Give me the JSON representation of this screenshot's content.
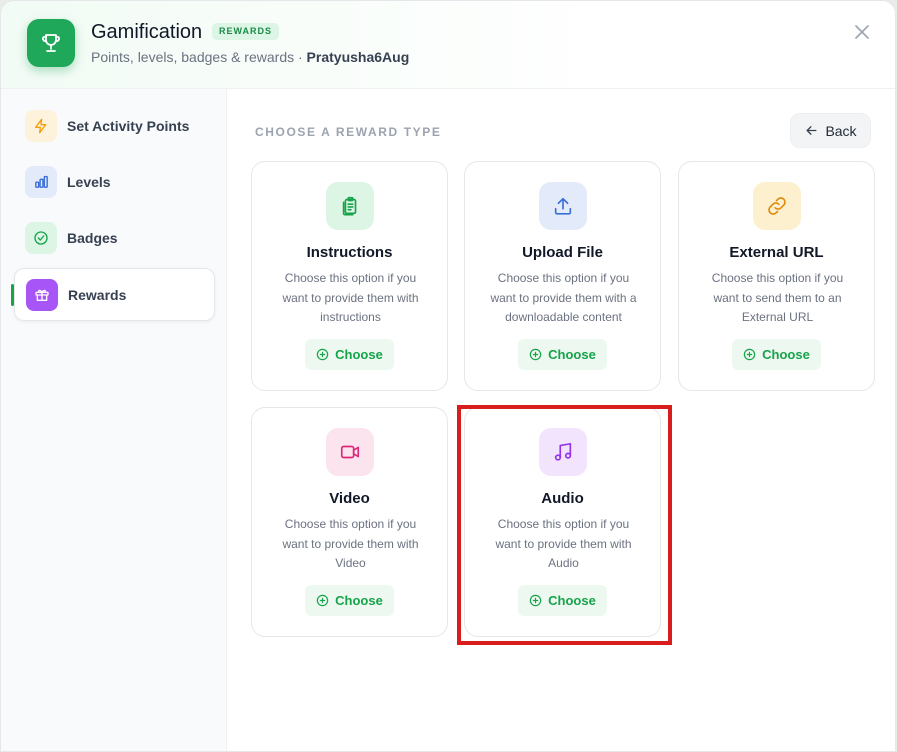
{
  "header": {
    "title": "Gamification",
    "badge": "REWARDS",
    "subtitle": "Points, levels, badges & rewards · ",
    "user": "Pratyusha6Aug"
  },
  "sidebar": {
    "items": [
      {
        "label": "Set Activity Points",
        "icon": "bolt-icon",
        "color": "#f59e0b",
        "bg": "#fdf3dc"
      },
      {
        "label": "Levels",
        "icon": "bar-chart-icon",
        "color": "#3b6fd8",
        "bg": "#e3ebfb"
      },
      {
        "label": "Badges",
        "icon": "check-circle-icon",
        "color": "#16a34a",
        "bg": "#dcf5e4"
      },
      {
        "label": "Rewards",
        "icon": "gift-icon",
        "color": "#ffffff",
        "bg": "#a855f7",
        "active": true
      }
    ]
  },
  "main": {
    "section_title": "CHOOSE A REWARD TYPE",
    "back_label": "Back",
    "choose_label": "Choose",
    "cards": [
      {
        "title": "Instructions",
        "desc": "Choose this option if you want to provide them with instructions",
        "icon": "clipboard-icon",
        "color": "#16a34a",
        "bg": "#dcf5e4"
      },
      {
        "title": "Upload File",
        "desc": "Choose this option if you want to provide them with a downloadable content",
        "icon": "upload-icon",
        "color": "#3b6fd8",
        "bg": "#e3ebfb"
      },
      {
        "title": "External URL",
        "desc": "Choose this option if you want to send them to an External URL",
        "icon": "link-icon",
        "color": "#e08a0b",
        "bg": "#fdf0cf"
      },
      {
        "title": "Video",
        "desc": "Choose this option if you want to provide them with Video",
        "icon": "video-icon",
        "color": "#db2777",
        "bg": "#fce4ef"
      },
      {
        "title": "Audio",
        "desc": "Choose this option if you want to provide them with Audio",
        "icon": "music-icon",
        "color": "#9333ea",
        "bg": "#f1e4fc"
      }
    ]
  },
  "colors": {
    "accent": "#16a34a",
    "highlight": "#d91c1c"
  }
}
